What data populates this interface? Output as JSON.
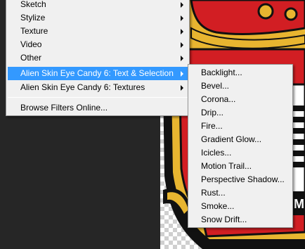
{
  "filter_menu": {
    "items": [
      {
        "label": "Sketch",
        "has_submenu": true
      },
      {
        "label": "Stylize",
        "has_submenu": true
      },
      {
        "label": "Texture",
        "has_submenu": true
      },
      {
        "label": "Video",
        "has_submenu": true
      },
      {
        "label": "Other",
        "has_submenu": true
      },
      {
        "label": "Alien Skin Eye Candy 6: Text & Selection",
        "has_submenu": true,
        "highlighted": true
      },
      {
        "label": "Alien Skin Eye Candy 6: Textures",
        "has_submenu": true
      },
      {
        "label": "Browse Filters Online...",
        "has_submenu": false
      }
    ]
  },
  "submenu": {
    "items": [
      "Backlight...",
      "Bevel...",
      "Corona...",
      "Drip...",
      "Fire...",
      "Gradient Glow...",
      "Icicles...",
      "Motion Trail...",
      "Perspective Shadow...",
      "Rust...",
      "Smoke...",
      "Snow Drift..."
    ]
  },
  "canvas": {
    "badge_letter": "M"
  },
  "colors": {
    "menu_bg": "#f0f0f0",
    "highlight": "#3399ff",
    "workspace": "#262626"
  }
}
